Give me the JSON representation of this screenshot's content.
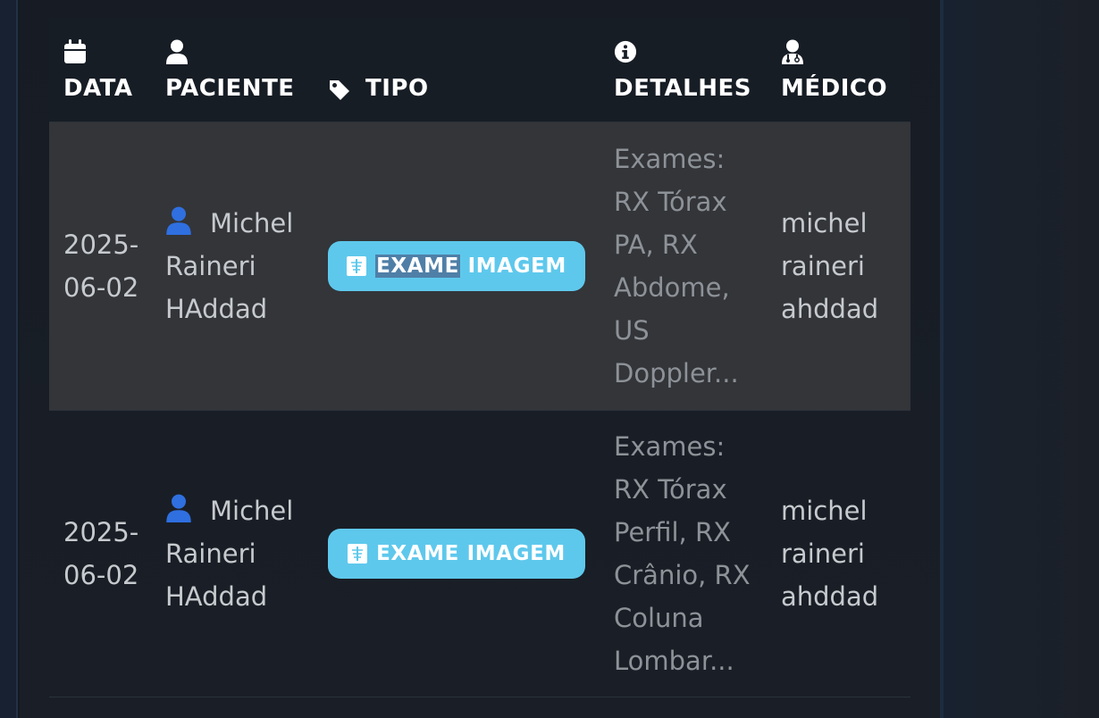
{
  "headers": {
    "data": "DATA",
    "paciente": "PACIENTE",
    "tipo": "TIPO",
    "detalhes": "DETALHES",
    "medico": "MÉDICO"
  },
  "header_icons": {
    "data": "calendar-icon",
    "paciente": "user-icon",
    "tipo": "tag-icon",
    "detalhes": "info-circle-icon",
    "medico": "user-doctor-icon"
  },
  "rows": [
    {
      "date_line1": "2025-",
      "date_line2": "06-02",
      "patient_line1": "Michel",
      "patient_line2": "Raineri",
      "patient_line3": "HAddad",
      "type_part1": "EXAME",
      "type_part2": "IMAGEM",
      "details": [
        "Exames:",
        "RX Tórax",
        "PA, RX",
        "Abdome,",
        "US",
        "Doppler..."
      ],
      "doctor": [
        "michel",
        "raineri",
        "ahddad"
      ]
    },
    {
      "date_line1": "2025-",
      "date_line2": "06-02",
      "patient_line1": "Michel",
      "patient_line2": "Raineri",
      "patient_line3": "HAddad",
      "type_part1": "EXAME",
      "type_part2": "IMAGEM",
      "details": [
        "Exames:",
        "RX Tórax",
        "Perfil, RX",
        "Crânio, RX",
        "Coluna",
        "Lombar..."
      ],
      "doctor": [
        "michel",
        "raineri",
        "ahddad"
      ]
    }
  ],
  "colors": {
    "badge": "#5ec8ec",
    "patient_icon": "#2f6fe0",
    "selection": "#4f7fa7"
  }
}
